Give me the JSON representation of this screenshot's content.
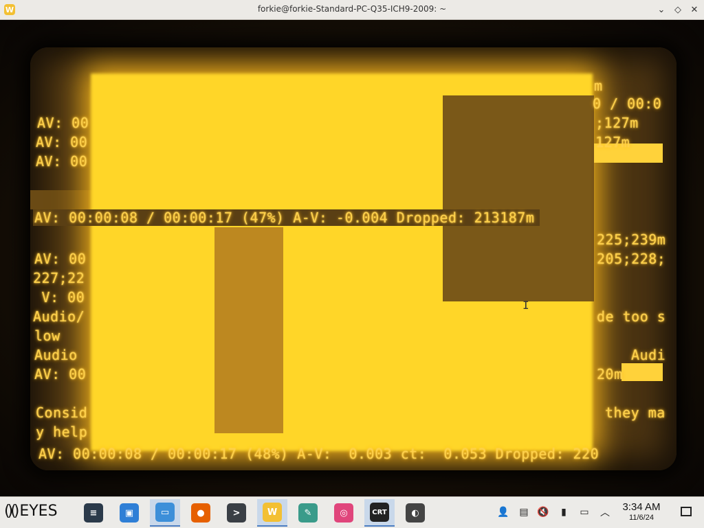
{
  "window": {
    "title": "forkie@forkie-Standard-PC-Q35-ICH9-2009: ~",
    "app_icon_letter": "W",
    "controls": {
      "minimize": "⌄",
      "maximize": "◇",
      "close": "✕"
    }
  },
  "terminal": {
    "top_right_fragments": [
      "m",
      "0 / 00:0",
      ";127m",
      "127m"
    ],
    "left_fragments_top": [
      "AV: 00",
      "AV: 00",
      "AV: 00"
    ],
    "highlight_line": "AV: 00:00:08 / 00:00:17 (47%) A-V: -0.004 Dropped: 213187m",
    "right_fragments_mid": [
      "225;239m",
      "205;228;"
    ],
    "left_fragments_mid": [
      "AV: 00",
      "227;22",
      " V: 00",
      "Audio/",
      "low",
      "Audio",
      "AV: 00"
    ],
    "right_fragments_low": [
      "de too s",
      "Audi",
      "20m"
    ],
    "left_fragments_bottom": [
      "Consid",
      "y help"
    ],
    "right_fragments_bottom": [
      "they ma"
    ],
    "status_line": "AV: 00:00:08 / 00:00:17 (48%) A-V:  0.003 ct:  0.053 Dropped: 220"
  },
  "taskbar": {
    "logo_text": "EYES",
    "apps": [
      {
        "name": "settings-app",
        "glyph": "≡",
        "color": "#2b3a4a"
      },
      {
        "name": "app-store",
        "glyph": "▣",
        "color": "#2f7fd6"
      },
      {
        "name": "file-manager",
        "glyph": "▭",
        "color": "#3c8fd9"
      },
      {
        "name": "firefox",
        "glyph": "●",
        "color": "#e66000"
      },
      {
        "name": "terminal",
        "glyph": ">",
        "color": "#3a3f45"
      },
      {
        "name": "w-app",
        "glyph": "W",
        "color": "#f3c033"
      },
      {
        "name": "drawing-app",
        "glyph": "✎",
        "color": "#3a9b8a"
      },
      {
        "name": "color-app",
        "glyph": "◎",
        "color": "#e0457b"
      },
      {
        "name": "crt-app",
        "glyph": "CRT",
        "color": "#222222"
      },
      {
        "name": "media-app",
        "glyph": "◐",
        "color": "#444444"
      }
    ],
    "tray": {
      "icons": [
        "person-icon",
        "clipboard-icon",
        "volume-muted-icon",
        "usb-icon",
        "network-icon",
        "expand-tray-icon"
      ],
      "time": "3:34 AM",
      "date": "11/6/24"
    }
  }
}
